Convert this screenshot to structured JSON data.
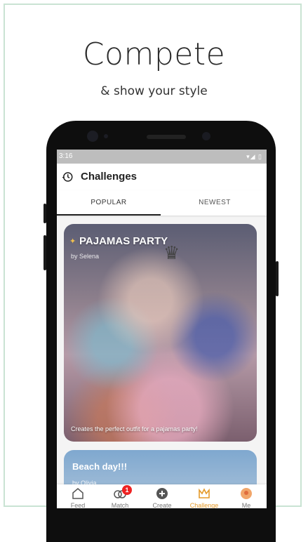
{
  "promo": {
    "headline": "Compete",
    "subhead": "& show your style"
  },
  "status_bar": {
    "time": "3:16",
    "icons": "▾◢ ▯"
  },
  "app_bar": {
    "title": "Challenges"
  },
  "tabs": [
    {
      "label": "POPULAR",
      "active": true
    },
    {
      "label": "NEWEST",
      "active": false
    }
  ],
  "challenges": [
    {
      "title": "PAJAMAS PARTY",
      "author": "by Selena",
      "description": "Creates the perfect outfit for a pajamas party!"
    },
    {
      "title": "Beach day!!!",
      "author": "by Olivia"
    }
  ],
  "bottom_nav": [
    {
      "label": "Feed",
      "icon": "home-icon"
    },
    {
      "label": "Match",
      "icon": "match-icon",
      "badge": "1"
    },
    {
      "label": "Create",
      "icon": "plus-circle-icon"
    },
    {
      "label": "Challenge",
      "icon": "crown-icon",
      "active": true
    },
    {
      "label": "Me",
      "icon": "avatar-icon"
    }
  ],
  "colors": {
    "accent": "#e59a2a",
    "badge": "#e22222",
    "frame_border": "#c9e3d3"
  }
}
